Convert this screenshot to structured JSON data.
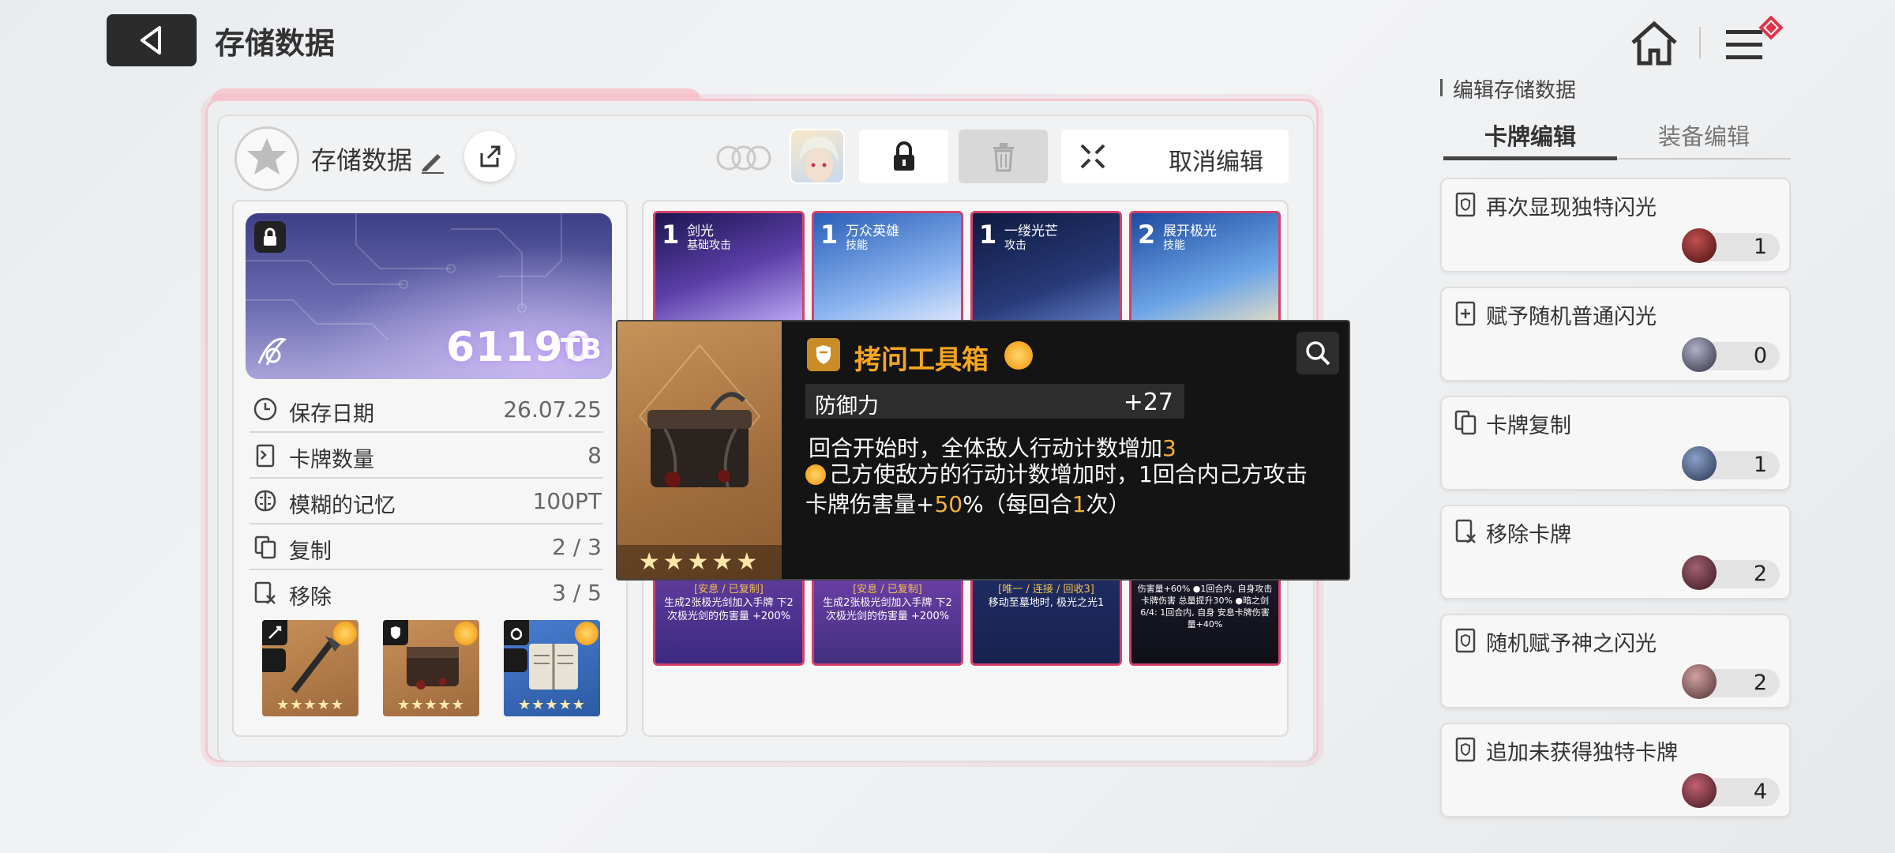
{
  "header": {
    "title": "存储数据"
  },
  "panel": {
    "save_name": "存储数据",
    "cancel_edit_label": "取消编辑"
  },
  "storage": {
    "value": "61190",
    "unit": "TB"
  },
  "stats": [
    {
      "label": "保存日期",
      "value": "26.07.25",
      "icon": "clock-icon"
    },
    {
      "label": "卡牌数量",
      "value": "8",
      "icon": "card-icon"
    },
    {
      "label": "模糊的记忆",
      "value": "100PT",
      "icon": "brain-icon"
    },
    {
      "label": "复制",
      "value": "2 / 3",
      "icon": "copy-icon"
    },
    {
      "label": "移除",
      "value": "3 / 5",
      "icon": "remove-card-icon"
    }
  ],
  "equipment": [
    {
      "slot": "weapon",
      "stars": "★★★★★",
      "bg": "#b8824f"
    },
    {
      "slot": "armor",
      "stars": "★★★★★",
      "bg": "#b8824f"
    },
    {
      "slot": "accessory",
      "stars": "★★★★★",
      "bg": "#3d6fb8"
    }
  ],
  "cards": [
    {
      "cost": "1",
      "name": "剑光",
      "type": "基础攻击",
      "desc_tag": "[安息 / 已复制]",
      "desc": "生成2张极光剑加入手牌 下2次极光剑的伤害量 +200%",
      "art": "#5b3fa8"
    },
    {
      "cost": "1",
      "name": "万众英雄",
      "type": "技能",
      "desc_tag": "[安息 / 已复制]",
      "desc": "生成2张极光剑加入手牌 下2次极光剑的伤害量 +200%",
      "art": "#4c7ed9"
    },
    {
      "cost": "1",
      "name": "一缕光芒",
      "type": "攻击",
      "desc_tag": "[唯一 / 连接 / 回收3]",
      "desc": "移动至墓地时, 极光之光1",
      "art": "#283a78"
    },
    {
      "cost": "2",
      "name": "展开极光",
      "type": "技能",
      "desc_tag": "",
      "desc": "伤害量+60% ●1回合内, 自身攻击卡牌伤害 总量提升30% ●暗之剑6/4: 1回合内, 自身 安息卡牌伤害量+40%",
      "art": "#3a6fc4"
    }
  ],
  "tooltip": {
    "title": "拷问工具箱",
    "stars": "★★★★★",
    "stat_label": "防御力",
    "stat_value": "+27",
    "effect1_pre": "回合开始时，全体敌人行动计数增加",
    "effect1_num": "3",
    "effect2_a": "己方使敌方的行动计数增加时，1回合内己方攻击卡牌伤害量+",
    "effect2_num1": "50",
    "effect2_b": "%（每回合",
    "effect2_num2": "1",
    "effect2_c": "次）"
  },
  "sidebar": {
    "title": "编辑存储数据",
    "tabs": [
      "卡牌编辑",
      "装备编辑"
    ],
    "options": [
      {
        "label": "再次显现独特闪光",
        "cost": "1",
        "orb": "#8a2a2a"
      },
      {
        "label": "赋予随机普通闪光",
        "cost": "0",
        "orb": "#5d5d70"
      },
      {
        "label": "卡牌复制",
        "cost": "1",
        "orb": "#4a5a7a"
      },
      {
        "label": "移除卡牌",
        "cost": "2",
        "orb": "#6a3a4a"
      },
      {
        "label": "随机赋予神之闪光",
        "cost": "2",
        "orb": "#8a5a5a"
      },
      {
        "label": "追加未获得独特卡牌",
        "cost": "4",
        "orb": "#8a3a4a"
      }
    ]
  },
  "colors": {
    "accent": "#f6a520",
    "card_border": "#d3416a",
    "panel_border": "#f4c7cf"
  }
}
